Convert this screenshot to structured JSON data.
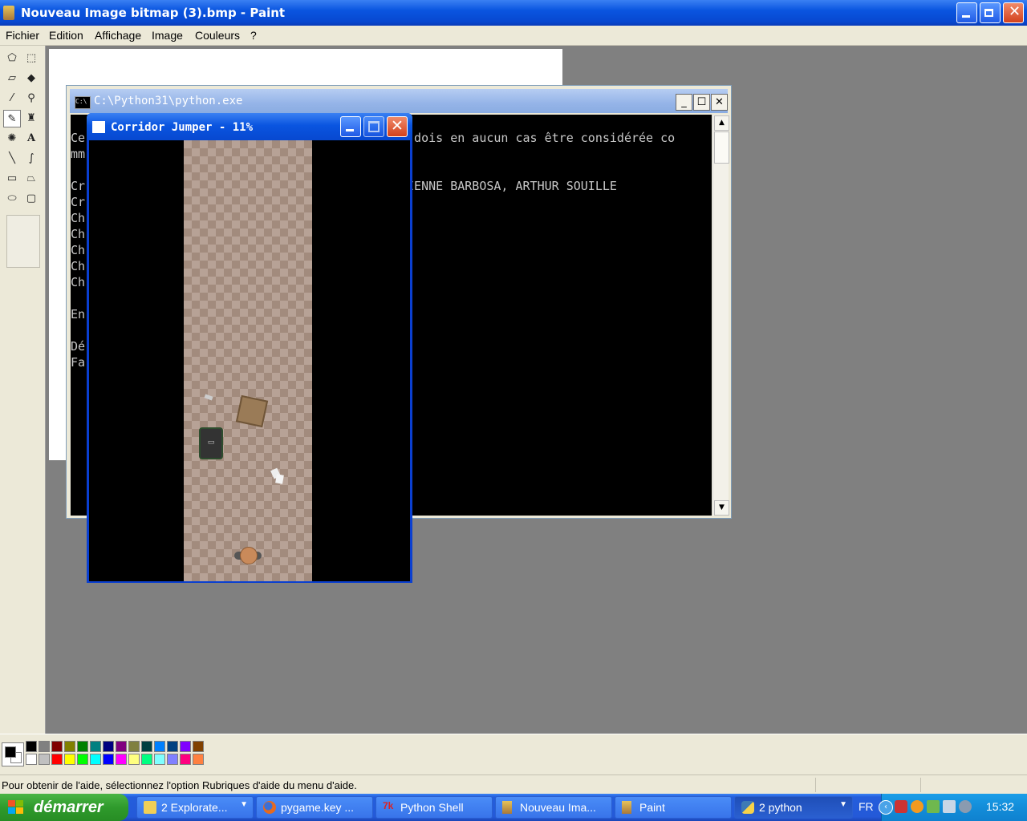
{
  "paint": {
    "title": "Nouveau Image bitmap (3).bmp - Paint",
    "menu": [
      "Fichier",
      "Edition",
      "Affichage",
      "Image",
      "Couleurs",
      "?"
    ],
    "tools": [
      {
        "name": "free-select",
        "glyph": "⬠"
      },
      {
        "name": "rect-select",
        "glyph": "⬚"
      },
      {
        "name": "eraser",
        "glyph": "▱"
      },
      {
        "name": "fill",
        "glyph": "◆"
      },
      {
        "name": "color-picker",
        "glyph": "⁄"
      },
      {
        "name": "magnifier",
        "glyph": "⚲"
      },
      {
        "name": "pencil",
        "glyph": "✎"
      },
      {
        "name": "brush",
        "glyph": "♜"
      },
      {
        "name": "airbrush",
        "glyph": "✺"
      },
      {
        "name": "text",
        "glyph": "A"
      },
      {
        "name": "line",
        "glyph": "╲"
      },
      {
        "name": "curve",
        "glyph": "∫"
      },
      {
        "name": "rectangle",
        "glyph": "▭"
      },
      {
        "name": "polygon",
        "glyph": "⏢"
      },
      {
        "name": "ellipse",
        "glyph": "⬭"
      },
      {
        "name": "rounded-rect",
        "glyph": "▢"
      }
    ],
    "palette_top": [
      "#000000",
      "#808080",
      "#800000",
      "#808000",
      "#008000",
      "#008080",
      "#000080",
      "#800080",
      "#808040",
      "#004040",
      "#0080ff",
      "#004080",
      "#8000ff",
      "#804000"
    ],
    "palette_bottom": [
      "#ffffff",
      "#c0c0c0",
      "#ff0000",
      "#ffff00",
      "#00ff00",
      "#00ffff",
      "#0000ff",
      "#ff00ff",
      "#ffff80",
      "#00ff80",
      "#80ffff",
      "#8080ff",
      "#ff0080",
      "#ff8040"
    ],
    "status": "Pour obtenir de l'aide, sélectionnez l'option Rubriques d'aide du menu d'aide."
  },
  "console": {
    "title": "C:\\Python31\\python.exe",
    "lines": [
      {
        "left": "Ce",
        "right": "e dois en aucun cas être considérée co"
      },
      {
        "left": "mm",
        "right": ""
      },
      {
        "left": "",
        "right": ""
      },
      {
        "left": "Cr",
        "right": "TIENNE BARBOSA, ARTHUR SOUILLE"
      },
      {
        "left": "Cr",
        "right": ""
      },
      {
        "left": "Ch",
        "right": ""
      },
      {
        "left": "Ch",
        "right": ""
      },
      {
        "left": "Ch",
        "right": ""
      },
      {
        "left": "Ch",
        "right": ""
      },
      {
        "left": "Ch",
        "right": ""
      },
      {
        "left": "",
        "right": ""
      },
      {
        "left": "En",
        "right": ""
      },
      {
        "left": "",
        "right": ""
      },
      {
        "left": "Dé",
        "right": ""
      },
      {
        "left": "Fa",
        "right": ""
      }
    ]
  },
  "game": {
    "title": "Corridor Jumper - 11%",
    "progress_percent": 11
  },
  "taskbar": {
    "start_label": "démarrer",
    "items": [
      {
        "label": "2 Explorate...",
        "icon": "folder-icon",
        "group": true
      },
      {
        "label": "pygame.key ...",
        "icon": "firefox-icon",
        "group": false
      },
      {
        "label": "Python Shell",
        "icon": "idle-icon",
        "group": false
      },
      {
        "label": "Nouveau Ima...",
        "icon": "paint-icon",
        "group": false
      },
      {
        "label": "Paint",
        "icon": "paint-icon",
        "group": false
      },
      {
        "label": "2 python",
        "icon": "python-icon",
        "group": true,
        "active": true
      }
    ],
    "language": "FR",
    "clock": "15:32"
  }
}
